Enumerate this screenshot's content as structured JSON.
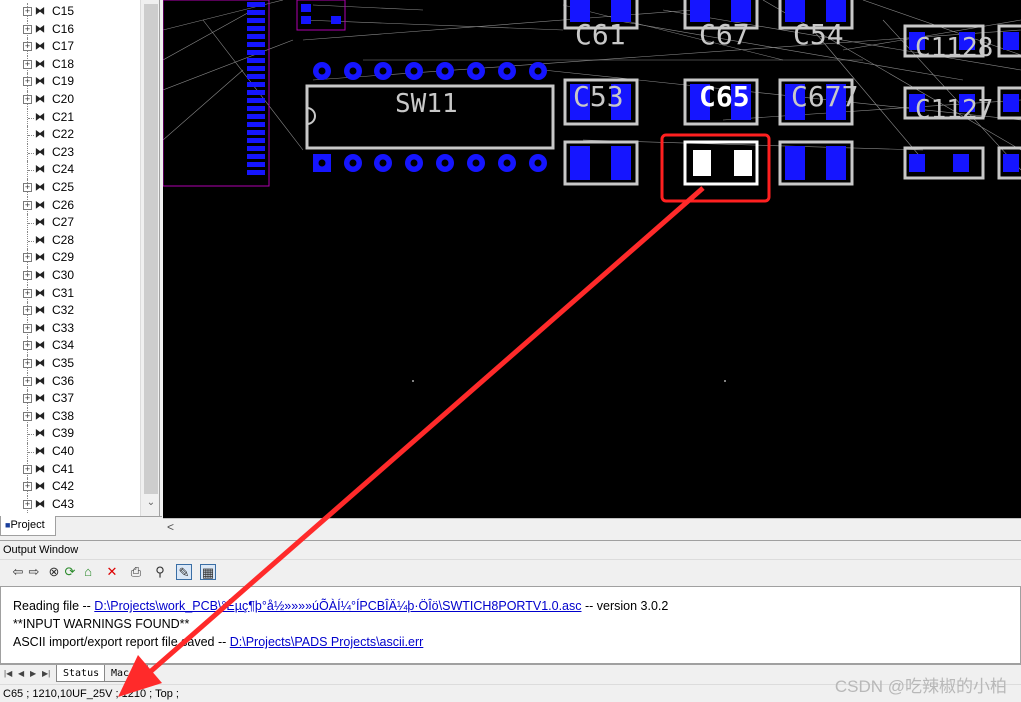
{
  "tree": {
    "items": [
      {
        "label": "C15",
        "expandable": true
      },
      {
        "label": "C16",
        "expandable": true
      },
      {
        "label": "C17",
        "expandable": true
      },
      {
        "label": "C18",
        "expandable": true
      },
      {
        "label": "C19",
        "expandable": true
      },
      {
        "label": "C20",
        "expandable": true
      },
      {
        "label": "C21",
        "expandable": false
      },
      {
        "label": "C22",
        "expandable": false
      },
      {
        "label": "C23",
        "expandable": false
      },
      {
        "label": "C24",
        "expandable": false
      },
      {
        "label": "C25",
        "expandable": true
      },
      {
        "label": "C26",
        "expandable": true
      },
      {
        "label": "C27",
        "expandable": false
      },
      {
        "label": "C28",
        "expandable": false
      },
      {
        "label": "C29",
        "expandable": true
      },
      {
        "label": "C30",
        "expandable": true
      },
      {
        "label": "C31",
        "expandable": true
      },
      {
        "label": "C32",
        "expandable": true
      },
      {
        "label": "C33",
        "expandable": true
      },
      {
        "label": "C34",
        "expandable": true
      },
      {
        "label": "C35",
        "expandable": true
      },
      {
        "label": "C36",
        "expandable": true
      },
      {
        "label": "C37",
        "expandable": true
      },
      {
        "label": "C38",
        "expandable": true
      },
      {
        "label": "C39",
        "expandable": false
      },
      {
        "label": "C40",
        "expandable": false
      },
      {
        "label": "C41",
        "expandable": true
      },
      {
        "label": "C42",
        "expandable": true
      },
      {
        "label": "C43",
        "expandable": true
      }
    ],
    "project_tab": "Project"
  },
  "pcb": {
    "component_labels": [
      "C61",
      "C67",
      "C54",
      "C1128",
      "C53",
      "C65",
      "C677",
      "C1127",
      "SW11"
    ],
    "highlighted_component": "C65",
    "colors": {
      "background": "#000000",
      "pad": "#1515ff",
      "outline": "#c8c8c8",
      "highlight_box": "#ff2020",
      "selected_pad": "#ffffff"
    }
  },
  "output": {
    "title": "Output Window",
    "lines": [
      {
        "prefix": "Reading file -- ",
        "link": "D:\\Projects\\work_PCB\\°Ëµç¶þ°å½»»»»úÕÀÍ¼°ÍPCBÎÄ¼þ·ÖÎö\\SWTICH8PORTV1.0.asc",
        "suffix": "  -- version 3.0.2"
      },
      {
        "prefix": "**INPUT WARNINGS FOUND**",
        "link": "",
        "suffix": ""
      },
      {
        "prefix": "ASCII import/export report file saved -- ",
        "link": "D:\\Projects\\PADS Projects\\ascii.err",
        "suffix": ""
      }
    ],
    "tabs": [
      "Status",
      "Macro"
    ],
    "toolbar_icons": [
      "back-arrow-icon",
      "forward-arrow-icon",
      "stop-icon",
      "refresh-icon",
      "home-icon",
      "delete-icon",
      "print-icon",
      "find-icon",
      "edit-icon",
      "grid-icon"
    ]
  },
  "status_bar": {
    "text": "C65 ; 1210,10UF_25V ; 1210 ; Top ;"
  },
  "watermark": "CSDN @吃辣椒的小柏"
}
